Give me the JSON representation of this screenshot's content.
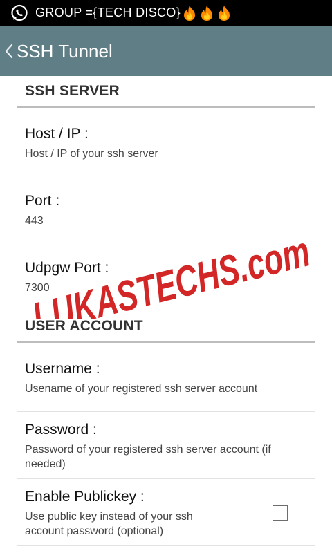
{
  "status_bar": {
    "text": "GROUP ={TECH DISCO}",
    "icons": [
      "whatsapp-icon",
      "fire-icon",
      "fire-icon",
      "fire-icon"
    ]
  },
  "action_bar": {
    "back_icon": "chevron-left-icon",
    "title": "SSH Tunnel",
    "background": "#5f7e85"
  },
  "sections": {
    "ssh_server": {
      "header": "SSH SERVER",
      "items": [
        {
          "title": "Host / IP :",
          "summary": "Host / IP of your ssh server"
        },
        {
          "title": "Port :",
          "summary": "443"
        },
        {
          "title": "Udpgw Port :",
          "summary": "7300"
        }
      ]
    },
    "user_account": {
      "header": "USER ACCOUNT",
      "items": [
        {
          "title": "Username :",
          "summary": "Usename of your registered ssh server account"
        },
        {
          "title": "Password :",
          "summary": "Password of your registered ssh server account (if needed)"
        },
        {
          "title": "Enable Publickey :",
          "summary": "Use public key instead of your ssh account password (optional)",
          "checked": false
        }
      ]
    }
  },
  "watermark": {
    "text": "LUKASTECHS.com",
    "color": "#d32626"
  }
}
